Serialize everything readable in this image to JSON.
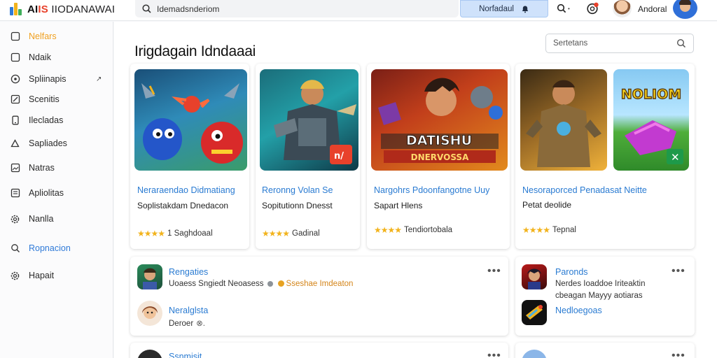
{
  "app": {
    "brand_left": "AI",
    "brand_mid": "IS",
    "brand_right": "IIODANAWAI"
  },
  "header": {
    "search_value": "Idemadsnderiom",
    "action_label": "Norfadaul",
    "user_name": "Andoral",
    "badge_color": "#e8412b"
  },
  "sidebar": {
    "items": [
      {
        "label": "Nelfars",
        "icon": "square-icon"
      },
      {
        "label": "Ndaik",
        "icon": "square-icon"
      },
      {
        "label": "Spliinapis",
        "icon": "compass-icon"
      },
      {
        "label": "Scenitis",
        "icon": "edit-icon"
      },
      {
        "label": "Ilecladas",
        "icon": "phone-icon"
      },
      {
        "label": "Sapliades",
        "icon": "tag-icon"
      },
      {
        "label": "Natras",
        "icon": "image-icon"
      },
      {
        "label": "Apliolitas",
        "icon": "document-icon"
      },
      {
        "label": "Nanlla",
        "icon": "gear-icon"
      },
      {
        "label": "Ropnacion",
        "icon": "search-icon"
      },
      {
        "label": "Hapait",
        "icon": "gear-icon"
      }
    ]
  },
  "main": {
    "title": "Irigdagain Idndaaai",
    "filter_placeholder": "Sertetans",
    "cards": [
      {
        "title": "Neraraendao Didmatiang",
        "subtitle": "Soplistakdam Dnedacon",
        "rating_text": "1 Saghdoaal",
        "stars": "★★★★"
      },
      {
        "title": "Reronng Volan Se",
        "subtitle": "Sopitutionn Dnesst",
        "rating_text": "Gadinal",
        "stars": "★★★★"
      },
      {
        "title": "Nargohrs Pdoonfangotne Uuy",
        "subtitle": "Sapart Hlens",
        "rating_text": "Tendiortobala",
        "stars": "★★★★"
      },
      {
        "title": "Nesoraporced Penadasat Neitte",
        "subtitle": "Petat deolide",
        "rating_text": "Tepnal",
        "stars": "★★★★"
      }
    ],
    "card_art": {
      "card3_banner_top": "DATISHU",
      "card3_banner_bottom": "DNERVOSSA",
      "card4b_title": "NOLIOM"
    },
    "list_left": [
      {
        "name": "Rengaties",
        "sub_left": "Uoaess Sngiedt Neoasess",
        "sub_right": "Sseshae Imdeaton"
      },
      {
        "name": "Neralglsta",
        "sub_left": "Deroer"
      },
      {
        "name": "Ssnmisit",
        "sub_left": ""
      }
    ],
    "list_right": [
      {
        "name": "Paronds",
        "sub_line1": "Nerdes Ioaddoe Iriteaktin",
        "sub_line2": "cbeagan Mayyy aotiaras"
      },
      {
        "name": "Nedloegoas",
        "sub_left": ""
      }
    ]
  }
}
